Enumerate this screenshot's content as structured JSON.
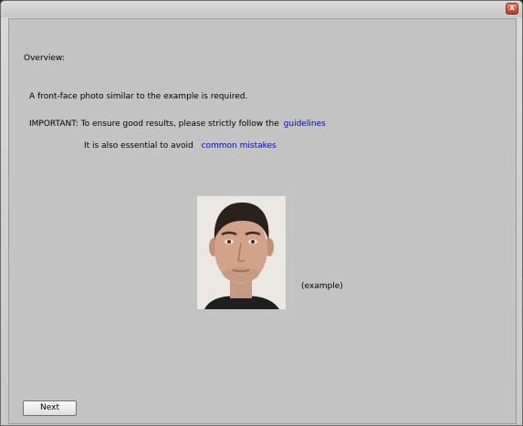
{
  "window": {
    "close_glyph": "x"
  },
  "overview": {
    "heading": "Overview:",
    "intro": "A front-face photo similar to the example is required.",
    "important_text": "IMPORTANT: To ensure good results, please strictly follow the",
    "guidelines_link": "guidelines",
    "avoid_text": "It is also essential to avoid",
    "mistakes_link": "common mistakes"
  },
  "example": {
    "caption": "(example)"
  },
  "footer": {
    "next_label": "Next"
  },
  "colors": {
    "link": "#0000e6",
    "panel_bg": "#c3c3c3",
    "close_button": "#c0391d"
  }
}
